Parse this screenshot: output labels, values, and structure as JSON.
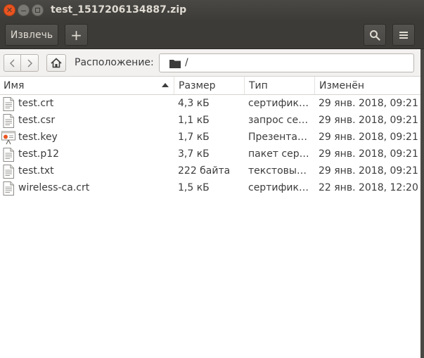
{
  "window": {
    "title": "test_1517206134887.zip"
  },
  "toolbar": {
    "extract_label": "Извлечь",
    "add_label": "+",
    "search_icon": "search-icon",
    "menu_icon": "hamburger-menu-icon"
  },
  "location": {
    "label": "Расположение:",
    "path": "/"
  },
  "columns": {
    "name": "Имя",
    "size": "Размер",
    "type": "Тип",
    "modified": "Изменён",
    "sort_column": "name",
    "sort_direction": "ascending"
  },
  "files": [
    {
      "name": "test.crt",
      "size": "4,3 кБ",
      "type": "сертифика…",
      "modified": "29 янв. 2018, 09:21",
      "icon": "text-file-icon"
    },
    {
      "name": "test.csr",
      "size": "1,1 кБ",
      "type": "запрос сер…",
      "modified": "29 янв. 2018, 09:21",
      "icon": "text-file-icon"
    },
    {
      "name": "test.key",
      "size": "1,7 кБ",
      "type": "Презентац…",
      "modified": "29 янв. 2018, 09:21",
      "icon": "presentation-file-icon"
    },
    {
      "name": "test.p12",
      "size": "3,7 кБ",
      "type": "пакет серт…",
      "modified": "29 янв. 2018, 09:21",
      "icon": "text-file-icon"
    },
    {
      "name": "test.txt",
      "size": "222 байта",
      "type": "текстовый …",
      "modified": "29 янв. 2018, 09:21",
      "icon": "text-file-icon"
    },
    {
      "name": "wireless-ca.crt",
      "size": "1,5 кБ",
      "type": "сертифика…",
      "modified": "22 янв. 2018, 12:20",
      "icon": "text-file-icon"
    }
  ],
  "colors": {
    "titlebar": "#3c3b37",
    "close_button": "#e95420",
    "background": "#ffffff"
  }
}
